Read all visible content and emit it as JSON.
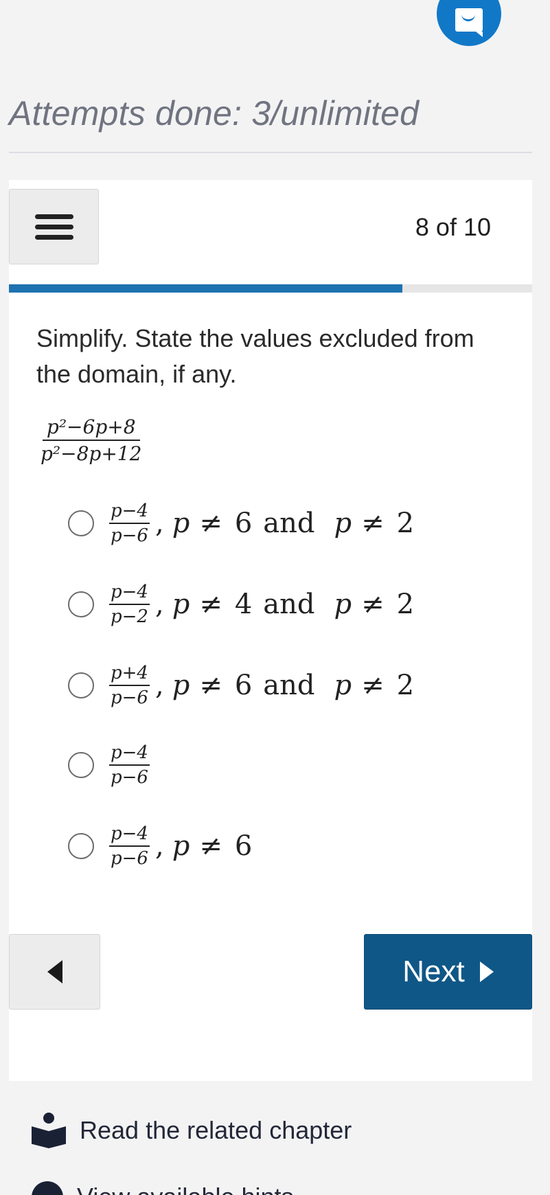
{
  "header": {
    "fab_icon": "book-reader-icon",
    "attempts_text": "Attempts done: 3/unlimited"
  },
  "quiz": {
    "counter": "8 of 10",
    "progress_fraction": 0.8,
    "prompt": "Simplify. State the values excluded from the domain, if any.",
    "expression": {
      "num": "p²−6p+8",
      "den": "p²−8p+12"
    },
    "options": [
      {
        "num": "p−4",
        "den": "p−6",
        "sep": ",",
        "cond": [
          {
            "var": "p",
            "op": "≠",
            "val": "6"
          },
          {
            "word": "and"
          },
          {
            "var": "p",
            "op": "≠",
            "val": "2"
          }
        ]
      },
      {
        "num": "p−4",
        "den": "p−2",
        "sep": ",",
        "cond": [
          {
            "var": "p",
            "op": "≠",
            "val": "4"
          },
          {
            "word": "and"
          },
          {
            "var": "p",
            "op": "≠",
            "val": "2"
          }
        ]
      },
      {
        "num": "p+4",
        "den": "p−6",
        "sep": ",",
        "cond": [
          {
            "var": "p",
            "op": "≠",
            "val": "6"
          },
          {
            "word": "and"
          },
          {
            "var": "p",
            "op": "≠",
            "val": "2"
          }
        ]
      },
      {
        "num": "p−4",
        "den": "p−6",
        "sep": "",
        "cond": []
      },
      {
        "num": "p−4",
        "den": "p−6",
        "sep": ",",
        "cond": [
          {
            "var": "p",
            "op": "≠",
            "val": "6"
          }
        ]
      }
    ],
    "prev_icon": "triangle-left-icon",
    "next_label": "Next",
    "next_icon": "triangle-right-icon"
  },
  "footer": {
    "related_label": "Read the related chapter",
    "related_icon": "reader-book-icon",
    "partial_label": "View available hints"
  }
}
